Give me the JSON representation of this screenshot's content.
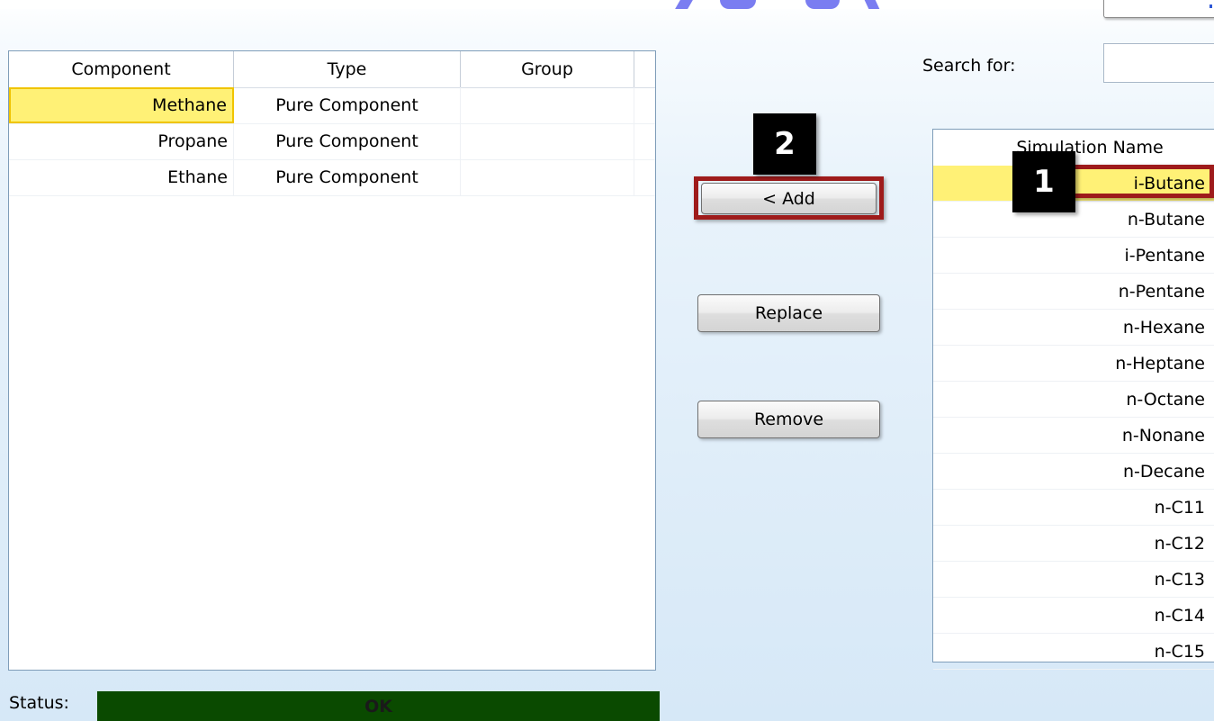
{
  "left_grid": {
    "columns": [
      "Component",
      "Type",
      "Group"
    ],
    "rows": [
      {
        "component": "Methane",
        "type": "Pure Component",
        "group": ""
      },
      {
        "component": "Propane",
        "type": "Pure Component",
        "group": ""
      },
      {
        "component": "Ethane",
        "type": "Pure Component",
        "group": ""
      }
    ],
    "selected_row": 0
  },
  "buttons": {
    "add": "< Add",
    "replace": "Replace",
    "remove": "Remove"
  },
  "callouts": {
    "step_1": "1",
    "step_2": "2",
    "frame_color": "#9e1b1b"
  },
  "search": {
    "label": "Search for:",
    "value": ""
  },
  "right_list": {
    "header": "Simulation Name",
    "items": [
      "i-Butane",
      "n-Butane",
      "i-Pentane",
      "n-Pentane",
      "n-Hexane",
      "n-Heptane",
      "n-Octane",
      "n-Nonane",
      "n-Decane",
      "n-C11",
      "n-C12",
      "n-C13",
      "n-C14",
      "n-C15"
    ],
    "selected_index": 0
  },
  "status": {
    "label": "Status:",
    "value": "OK",
    "color": "#0a4a00"
  },
  "colors": {
    "selection": "#fff176",
    "watermark": "#6b6ff0"
  }
}
